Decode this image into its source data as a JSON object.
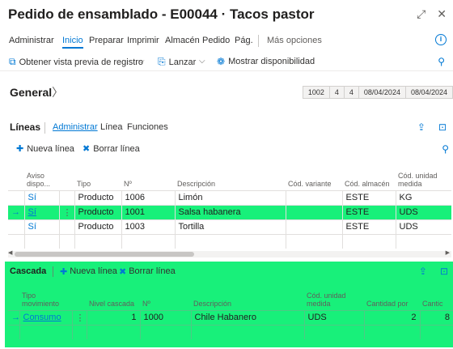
{
  "header": {
    "title": "Pedido de ensamblado - E00044 · Tacos pastor",
    "expand_icon": "expand-icon",
    "close_icon": "close-icon"
  },
  "menu": {
    "items": [
      "Administrar",
      "Inicio",
      "Preparar",
      "Imprimir",
      "Almacén",
      "Pedido",
      "Pág."
    ],
    "active": "Inicio",
    "more": "Más opciones"
  },
  "actions": {
    "preview": "Obtener vista previa de registro",
    "release": "Lanzar",
    "availability": "Mostrar disponibilidad"
  },
  "general": {
    "title": "General",
    "values": [
      "1002",
      "4",
      "4",
      "08/04/2024",
      "08/04/2024"
    ]
  },
  "lines": {
    "title": "Líneas",
    "tabs": [
      "Administrar",
      "Línea",
      "Funciones"
    ],
    "new_line": "Nueva línea",
    "delete_line": "Borrar línea",
    "columns": {
      "aviso": "Aviso dispo...",
      "tipo": "Tipo",
      "no": "Nº",
      "descripcion": "Descripción",
      "variante": "Cód. variante",
      "almacen": "Cód. almacén",
      "unidad": "Cód. unidad medida"
    },
    "rows": [
      {
        "aviso": "Sí",
        "tipo": "Producto",
        "no": "1006",
        "descripcion": "Limón",
        "variante": "",
        "almacen": "ESTE",
        "unidad": "KG"
      },
      {
        "aviso": "Sí",
        "tipo": "Producto",
        "no": "1001",
        "descripcion": "Salsa habanera",
        "variante": "",
        "almacen": "ESTE",
        "unidad": "UDS"
      },
      {
        "aviso": "Sí",
        "tipo": "Producto",
        "no": "1003",
        "descripcion": "Tortilla",
        "variante": "",
        "almacen": "ESTE",
        "unidad": "UDS"
      }
    ],
    "selected_arrow": "→",
    "row_menu": "⋮"
  },
  "cascade": {
    "title": "Cascada",
    "new_line": "Nueva línea",
    "delete_line": "Borrar línea",
    "columns": {
      "tipo_mov": "Tipo movimiento",
      "nivel": "Nivel cascada",
      "no": "Nº",
      "descripcion": "Descripción",
      "unidad": "Cód. unidad medida",
      "cantidad_por": "Cantidad por",
      "cantidad": "Cantic"
    },
    "rows": [
      {
        "tipo_mov": "Consumo",
        "nivel": "1",
        "no": "1000",
        "descripcion": "Chile Habanero",
        "unidad": "UDS",
        "cantidad_por": "2",
        "cantidad": "8"
      }
    ]
  },
  "colors": {
    "accent": "#0078d4",
    "highlight": "#18f07a"
  }
}
